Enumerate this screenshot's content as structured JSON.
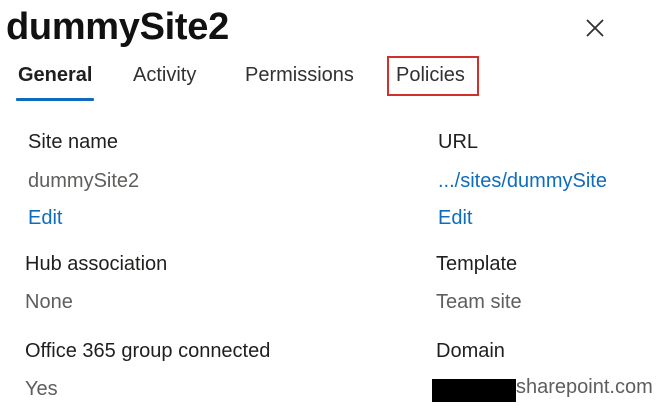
{
  "panel": {
    "title": "dummySite2"
  },
  "tabs": [
    {
      "label": "General",
      "active": true
    },
    {
      "label": "Activity",
      "active": false
    },
    {
      "label": "Permissions",
      "active": false
    },
    {
      "label": "Policies",
      "active": false
    }
  ],
  "fields": {
    "site_name": {
      "label": "Site name",
      "value": "dummySite2",
      "edit": "Edit"
    },
    "url": {
      "label": "URL",
      "value": ".../sites/dummySite",
      "edit": "Edit"
    },
    "hub_association": {
      "label": "Hub association",
      "value": "None"
    },
    "template": {
      "label": "Template",
      "value": "Team site"
    },
    "group_connected": {
      "label": "Office 365 group connected",
      "value": "Yes"
    },
    "domain": {
      "label": "Domain",
      "value_visible": "sharepoint.com"
    }
  },
  "colors": {
    "accent": "#0f6cbd",
    "highlight": "#d32f2f",
    "muted_text": "#605e5c"
  }
}
